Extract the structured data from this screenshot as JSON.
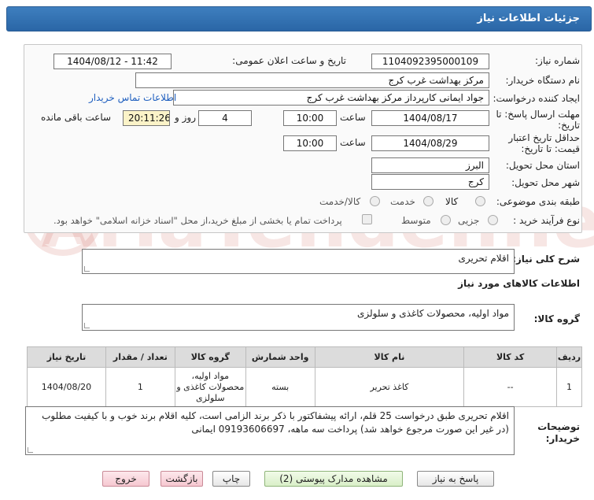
{
  "header": {
    "title": "جزئیات اطلاعات نیاز"
  },
  "watermark": {
    "text": "AriaTender.neT"
  },
  "form": {
    "need_number_label": "شماره نیاز:",
    "need_number": "1104092395000109",
    "announce_label": "تاریخ و ساعت اعلان عمومی:",
    "announce_value": "1404/08/12 - 11:42",
    "buyer_org_label": "نام دستگاه خریدار:",
    "buyer_org": "مرکز بهداشت غرب کرج",
    "requester_label": "ایجاد کننده درخواست:",
    "requester": "جواد ایمانی کارپرداز مرکز بهداشت غرب کرج",
    "contact_link": "اطلاعات تماس خریدار",
    "deadline_label_1": "مهلت ارسال پاسخ: تا",
    "deadline_label_2": "تاریخ:",
    "deadline_date": "1404/08/17",
    "time_label": "ساعت",
    "deadline_time": "10:00",
    "days_value": "4",
    "days_label": "روز و",
    "remaining_time": "20:11:26",
    "remaining_label": "ساعت باقی مانده",
    "validity_label_1": "حداقل تاریخ اعتبار",
    "validity_label_2": "قیمت: تا تاریخ:",
    "validity_date": "1404/08/29",
    "validity_time": "10:00",
    "province_label": "استان محل تحویل:",
    "province": "البرز",
    "city_label": "شهر محل تحویل:",
    "city": "کرج",
    "category_label": "طبقه بندی موضوعی:",
    "category_options": [
      "کالا",
      "خدمت",
      "کالا/خدمت"
    ],
    "process_label": "نوع فرآیند خرید :",
    "process_options": [
      "جزیی",
      "متوسط"
    ],
    "payment_note": "پرداخت تمام یا بخشی از مبلغ خرید،از محل \"اسناد خزانه اسلامی\" خواهد بود."
  },
  "summary": {
    "label": "شرح کلی نیاز:",
    "value": "اقلام تحریری"
  },
  "goods_info_title": "اطلاعات کالاهای مورد نیاز",
  "goods_group": {
    "label": "گروه کالا:",
    "value": "مواد اولیه، محصولات کاغذی و سلولزی"
  },
  "table": {
    "headers": [
      "ردیف",
      "کد کالا",
      "نام کالا",
      "واحد شمارش",
      "گروه کالا",
      "تعداد / مقدار",
      "تاریخ نیاز"
    ],
    "rows": [
      {
        "row": "1",
        "code": "--",
        "name": "کاغذ تحریر",
        "unit": "بسته",
        "group": "مواد اولیه، محصولات کاغذی و سلولزی",
        "qty": "1",
        "date": "1404/08/20"
      }
    ]
  },
  "buyer_notes": {
    "label_1": "توضیحات",
    "label_2": "خریدار:",
    "value": "اقلام تحریری طبق درخواست 25 قلم، ارائه پیشفاکتور با ذکر برند الزامی است، کلیه اقلام برند خوب و با کیفیت مطلوب (در غیر این صورت مرجوع خواهد شد) پرداخت سه ماهه، 09193606697 ایمانی"
  },
  "buttons": {
    "reply": "پاسخ به نیاز",
    "view_docs": "مشاهده مدارک پیوستی (2)",
    "print": "چاپ",
    "back": "بازگشت",
    "exit": "خروج"
  }
}
